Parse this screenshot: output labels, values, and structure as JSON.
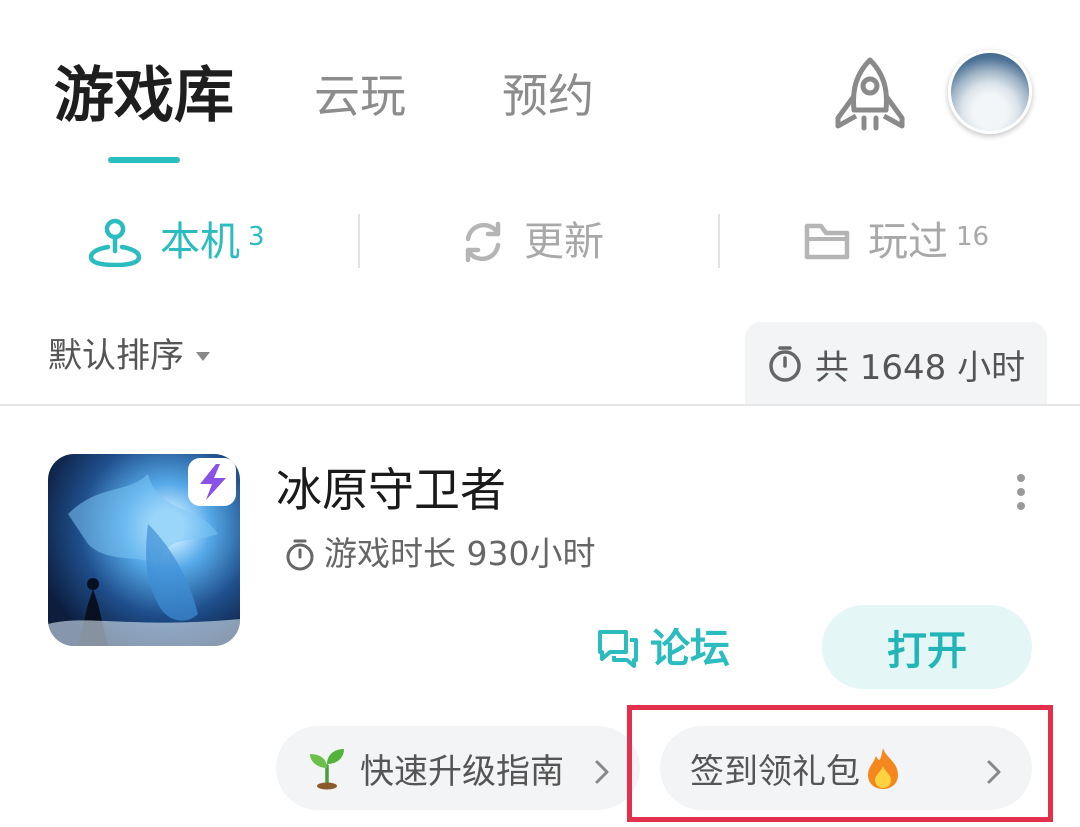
{
  "header": {
    "tabs": [
      {
        "label": "游戏库",
        "active": true
      },
      {
        "label": "云玩",
        "active": false
      },
      {
        "label": "预约",
        "active": false
      }
    ],
    "rocket_icon": "rocket-icon",
    "avatar_icon": "avatar"
  },
  "filters": {
    "local": {
      "label": "本机",
      "count": "3",
      "icon": "joystick-pin-icon",
      "active": true
    },
    "update": {
      "label": "更新",
      "icon": "refresh-icon"
    },
    "played": {
      "label": "玩过",
      "count": "16",
      "icon": "folder-icon"
    }
  },
  "sort": {
    "label": "默认排序"
  },
  "total": {
    "label": "共 1648 小时",
    "icon": "timer-icon"
  },
  "game": {
    "title": "冰原守卫者",
    "playtime": "游戏时长 930小时",
    "forum_label": "论坛",
    "open_label": "打开"
  },
  "chips": [
    {
      "label": "快速升级指南",
      "icon": "sprout-icon"
    },
    {
      "label": "签到领礼包",
      "icon": "fire-icon"
    }
  ],
  "colors": {
    "accent": "#2bbcc0",
    "highlight": "#e3314d",
    "text_primary": "#1e1e1e",
    "text_secondary": "#8c8c8c"
  }
}
